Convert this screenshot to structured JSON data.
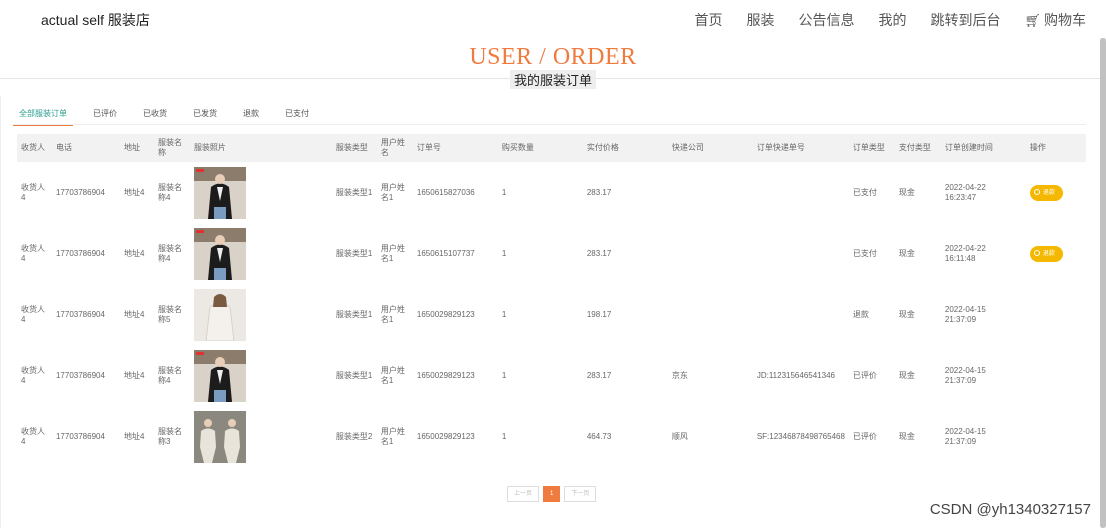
{
  "brand": "actual self 服装店",
  "nav": [
    "首页",
    "服装",
    "公告信息",
    "我的",
    "跳转到后台",
    "购物车"
  ],
  "header": {
    "title": "USER / ORDER",
    "subtitle": "我的服装订单"
  },
  "tabs": [
    "全部服装订单",
    "已评价",
    "已收货",
    "已发货",
    "退款",
    "已支付"
  ],
  "columns": [
    "收货人",
    "电话",
    "地址",
    "服装名称",
    "服装照片",
    "服装类型",
    "用户姓名",
    "订单号",
    "购买数量",
    "实付价格",
    "快递公司",
    "订单快递单号",
    "订单类型",
    "支付类型",
    "订单创建时间",
    "操作"
  ],
  "rows": [
    {
      "recipient": "收货人4",
      "phone": "17703786904",
      "address": "地址4",
      "name": "服装名称4",
      "type": "服装类型1",
      "user": "用户姓名1",
      "order_no": "1650615827036",
      "qty": "1",
      "price": "283.17",
      "courier": "",
      "tracking": "",
      "status": "已支付",
      "pay_type": "现金",
      "date": "2022-04-22",
      "time": "16:23:47",
      "action": "退款"
    },
    {
      "recipient": "收货人4",
      "phone": "17703786904",
      "address": "地址4",
      "name": "服装名称4",
      "type": "服装类型1",
      "user": "用户姓名1",
      "order_no": "1650615107737",
      "qty": "1",
      "price": "283.17",
      "courier": "",
      "tracking": "",
      "status": "已支付",
      "pay_type": "现金",
      "date": "2022-04-22",
      "time": "16:11:48",
      "action": "退款"
    },
    {
      "recipient": "收货人4",
      "phone": "17703786904",
      "address": "地址4",
      "name": "服装名称5",
      "type": "服装类型1",
      "user": "用户姓名1",
      "order_no": "1650029829123",
      "qty": "1",
      "price": "198.17",
      "courier": "",
      "tracking": "",
      "status": "退款",
      "pay_type": "现金",
      "date": "2022-04-15",
      "time": "21:37:09",
      "action": ""
    },
    {
      "recipient": "收货人4",
      "phone": "17703786904",
      "address": "地址4",
      "name": "服装名称4",
      "type": "服装类型1",
      "user": "用户姓名1",
      "order_no": "1650029829123",
      "qty": "1",
      "price": "283.17",
      "courier": "京东",
      "tracking": "JD:112315646541346",
      "status": "已评价",
      "pay_type": "现金",
      "date": "2022-04-15",
      "time": "21:37:09",
      "action": ""
    },
    {
      "recipient": "收货人4",
      "phone": "17703786904",
      "address": "地址4",
      "name": "服装名称3",
      "type": "服装类型2",
      "user": "用户姓名1",
      "order_no": "1650029829123",
      "qty": "1",
      "price": "464.73",
      "courier": "顺风",
      "tracking": "SF:12346878498765468",
      "status": "已评价",
      "pay_type": "现金",
      "date": "2022-04-15",
      "time": "21:37:09",
      "action": ""
    }
  ],
  "pagination": {
    "prev": "上一页",
    "current": "1",
    "next": "下一页"
  },
  "watermark": "CSDN @yh1340327157"
}
